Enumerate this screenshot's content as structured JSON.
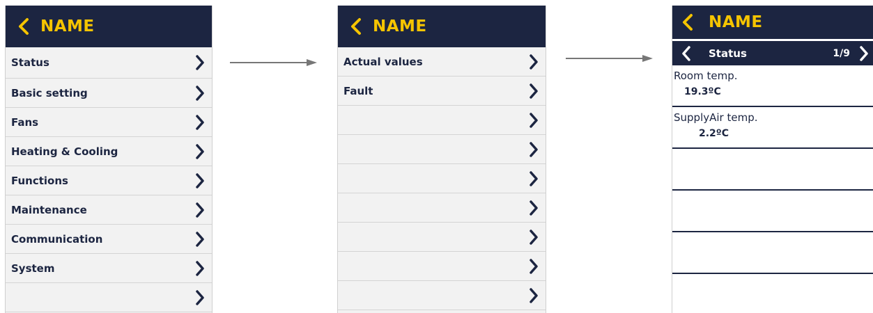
{
  "colors": {
    "header_bg": "#1c2541",
    "title_accent": "#f5c400",
    "row_bg": "#f2f2f2",
    "arrow": "#777777"
  },
  "screen1": {
    "title": "NAME",
    "back_icon": "chevron-left-icon",
    "items": [
      {
        "label": "Status"
      },
      {
        "label": "Basic setting"
      },
      {
        "label": "Fans"
      },
      {
        "label": "Heating & Cooling"
      },
      {
        "label": "Functions"
      },
      {
        "label": "Maintenance"
      },
      {
        "label": "Communication"
      },
      {
        "label": "System"
      },
      {
        "label": ""
      }
    ]
  },
  "screen2": {
    "title": "NAME",
    "back_icon": "chevron-left-icon",
    "items": [
      {
        "label": "Actual values"
      },
      {
        "label": "Fault"
      },
      {
        "label": ""
      },
      {
        "label": ""
      },
      {
        "label": ""
      },
      {
        "label": ""
      },
      {
        "label": ""
      },
      {
        "label": ""
      },
      {
        "label": ""
      }
    ]
  },
  "screen3": {
    "title": "NAME",
    "back_icon": "chevron-left-icon",
    "subnav": {
      "title": "Status",
      "page": "1/9",
      "prev_icon": "chevron-left-icon",
      "next_icon": "chevron-right-icon"
    },
    "values": [
      {
        "label": "Room temp.",
        "value": "19.3ºC"
      },
      {
        "label": "SupplyAir temp.",
        "value": "2.2ºC"
      },
      {
        "label": "",
        "value": ""
      },
      {
        "label": "",
        "value": ""
      },
      {
        "label": "",
        "value": ""
      }
    ]
  }
}
